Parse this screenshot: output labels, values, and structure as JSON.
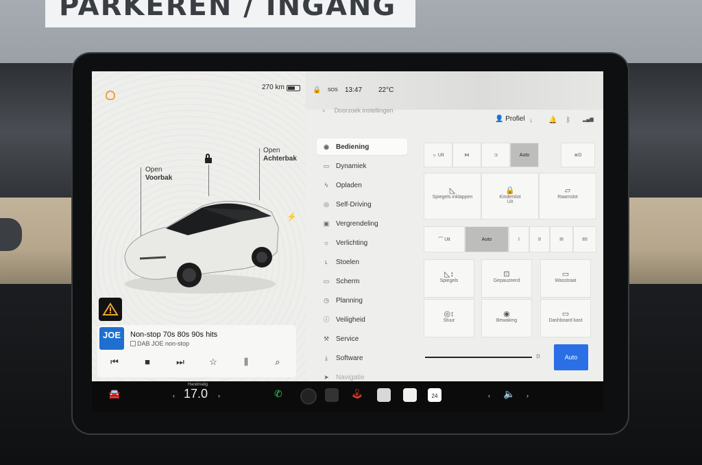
{
  "environment": {
    "sign_text": "PARKEREN / INGANG"
  },
  "status": {
    "range": "270 km",
    "sos": "SOS",
    "time": "13:47",
    "temperature": "22°C"
  },
  "car": {
    "front_label_top": "Open",
    "front_label_bottom": "Voorbak",
    "rear_label_top": "Open",
    "rear_label_bottom": "Achterbak"
  },
  "media": {
    "logo": "JOE",
    "title": "Non-stop 70s 80s 90s hits",
    "source": "DAB JOE non-stop",
    "controls": [
      "prev-icon",
      "stop-icon",
      "next-icon",
      "star-icon",
      "equalizer-icon",
      "search-icon"
    ]
  },
  "settings": {
    "search_placeholder": "Doorzoek instellingen",
    "profile": "Profiel",
    "nav": [
      {
        "icon": "toggle-icon",
        "label": "Bediening",
        "active": true
      },
      {
        "icon": "car-icon",
        "label": "Dynamiek"
      },
      {
        "icon": "bolt-icon",
        "label": "Opladen"
      },
      {
        "icon": "steering-icon",
        "label": "Self-Driving"
      },
      {
        "icon": "lock-icon",
        "label": "Vergrendeling"
      },
      {
        "icon": "light-icon",
        "label": "Verlichting"
      },
      {
        "icon": "seat-icon",
        "label": "Stoelen"
      },
      {
        "icon": "screen-icon",
        "label": "Scherm"
      },
      {
        "icon": "clock-icon",
        "label": "Planning"
      },
      {
        "icon": "shield-icon",
        "label": "Veiligheid"
      },
      {
        "icon": "wrench-icon",
        "label": "Service"
      },
      {
        "icon": "download-icon",
        "label": "Software"
      },
      {
        "icon": "nav-icon",
        "label": "Navigatie"
      }
    ],
    "lights": {
      "options": [
        "Uit",
        "",
        "",
        "Auto"
      ],
      "selected": "Auto"
    },
    "row2": [
      {
        "label": "Spiegels inklappen",
        "icon": "mirror-icon"
      },
      {
        "label": "Kinderslot",
        "sub": "Uit",
        "icon": "childlock-icon"
      },
      {
        "label": "Raamslot",
        "icon": "window-lock-icon"
      }
    ],
    "wipers": {
      "options": [
        "Uit",
        "Auto",
        "I",
        "II",
        "III",
        "IIII"
      ],
      "selected": "Auto"
    },
    "row4": [
      {
        "label": "Spiegels",
        "icon": "mirror-adjust-icon"
      },
      {
        "label": "Gepauzeerd",
        "icon": "camera-icon"
      },
      {
        "label": "Wasstraat",
        "icon": "carwash-icon"
      }
    ],
    "row5": [
      {
        "label": "Stuur",
        "icon": "steering-adjust-icon"
      },
      {
        "label": "Bewaking",
        "icon": "sentry-icon"
      },
      {
        "label": "Dashboard kast",
        "icon": "glovebox-icon"
      }
    ],
    "brightness_auto": "Auto"
  },
  "dock": {
    "temp_mode": "Handmatig",
    "temperature": "17.0",
    "calendar_day": "24"
  }
}
